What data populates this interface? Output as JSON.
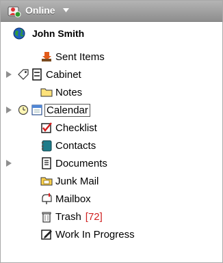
{
  "header": {
    "status_label": "Online",
    "status_icon": "user-status-icon",
    "bg": "#9a9a9a"
  },
  "user": {
    "name": "John Smith",
    "icon": "globe-icon"
  },
  "folders": [
    {
      "label": "Sent Items",
      "icon": "sent-items-icon",
      "expandable": false
    },
    {
      "label": "Cabinet",
      "icon": "cabinet-icon",
      "expandable": true
    },
    {
      "label": "Notes",
      "icon": "folder-icon",
      "expandable": false
    },
    {
      "label": "Calendar",
      "icon": "calendar-icon",
      "expandable": true,
      "selected": true
    },
    {
      "label": "Checklist",
      "icon": "checklist-icon",
      "expandable": false
    },
    {
      "label": "Contacts",
      "icon": "contacts-icon",
      "expandable": false
    },
    {
      "label": "Documents",
      "icon": "documents-icon",
      "expandable": true
    },
    {
      "label": "Junk Mail",
      "icon": "junk-mail-icon",
      "expandable": false
    },
    {
      "label": "Mailbox",
      "icon": "mailbox-icon",
      "expandable": false
    },
    {
      "label": "Trash",
      "icon": "trash-icon",
      "expandable": false,
      "count": "[72]"
    },
    {
      "label": "Work In Progress",
      "icon": "work-in-progress-icon",
      "expandable": false
    }
  ]
}
